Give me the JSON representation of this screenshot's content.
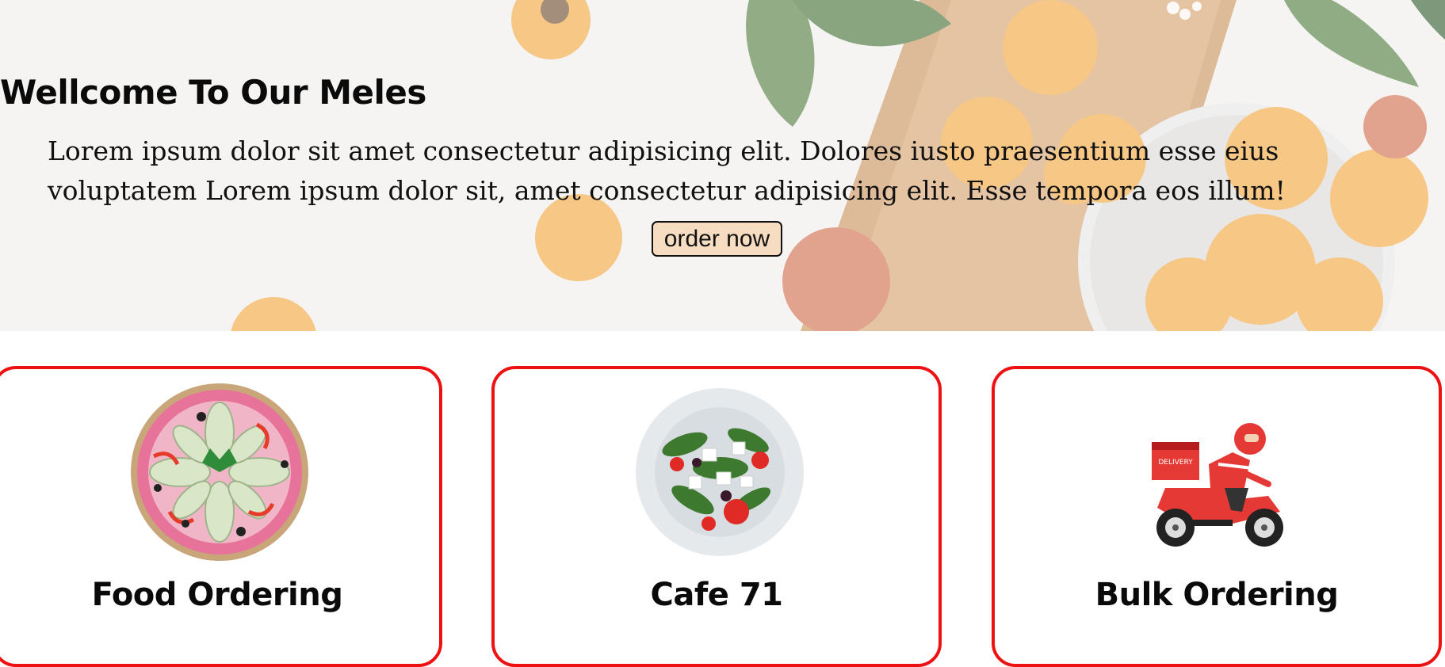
{
  "hero": {
    "title": "Wellcome To Our Meles",
    "text": "Lorem ipsum dolor sit amet consectetur adipisicing elit. Dolores iusto praesentium esse eius voluptatem Lorem ipsum dolor sit, amet consectetur adipisicing elit. Esse tempora eos illum!",
    "button_label": "order now",
    "button_color": "#f6dcc0"
  },
  "services": [
    {
      "title": "Food Ordering",
      "icon": "pizza-icon"
    },
    {
      "title": "Cafe 71",
      "icon": "salad-icon"
    },
    {
      "title": "Bulk Ordering",
      "icon": "delivery-scooter-icon"
    }
  ],
  "colors": {
    "card_border": "#ee1111",
    "text": "#0a0a0a"
  }
}
